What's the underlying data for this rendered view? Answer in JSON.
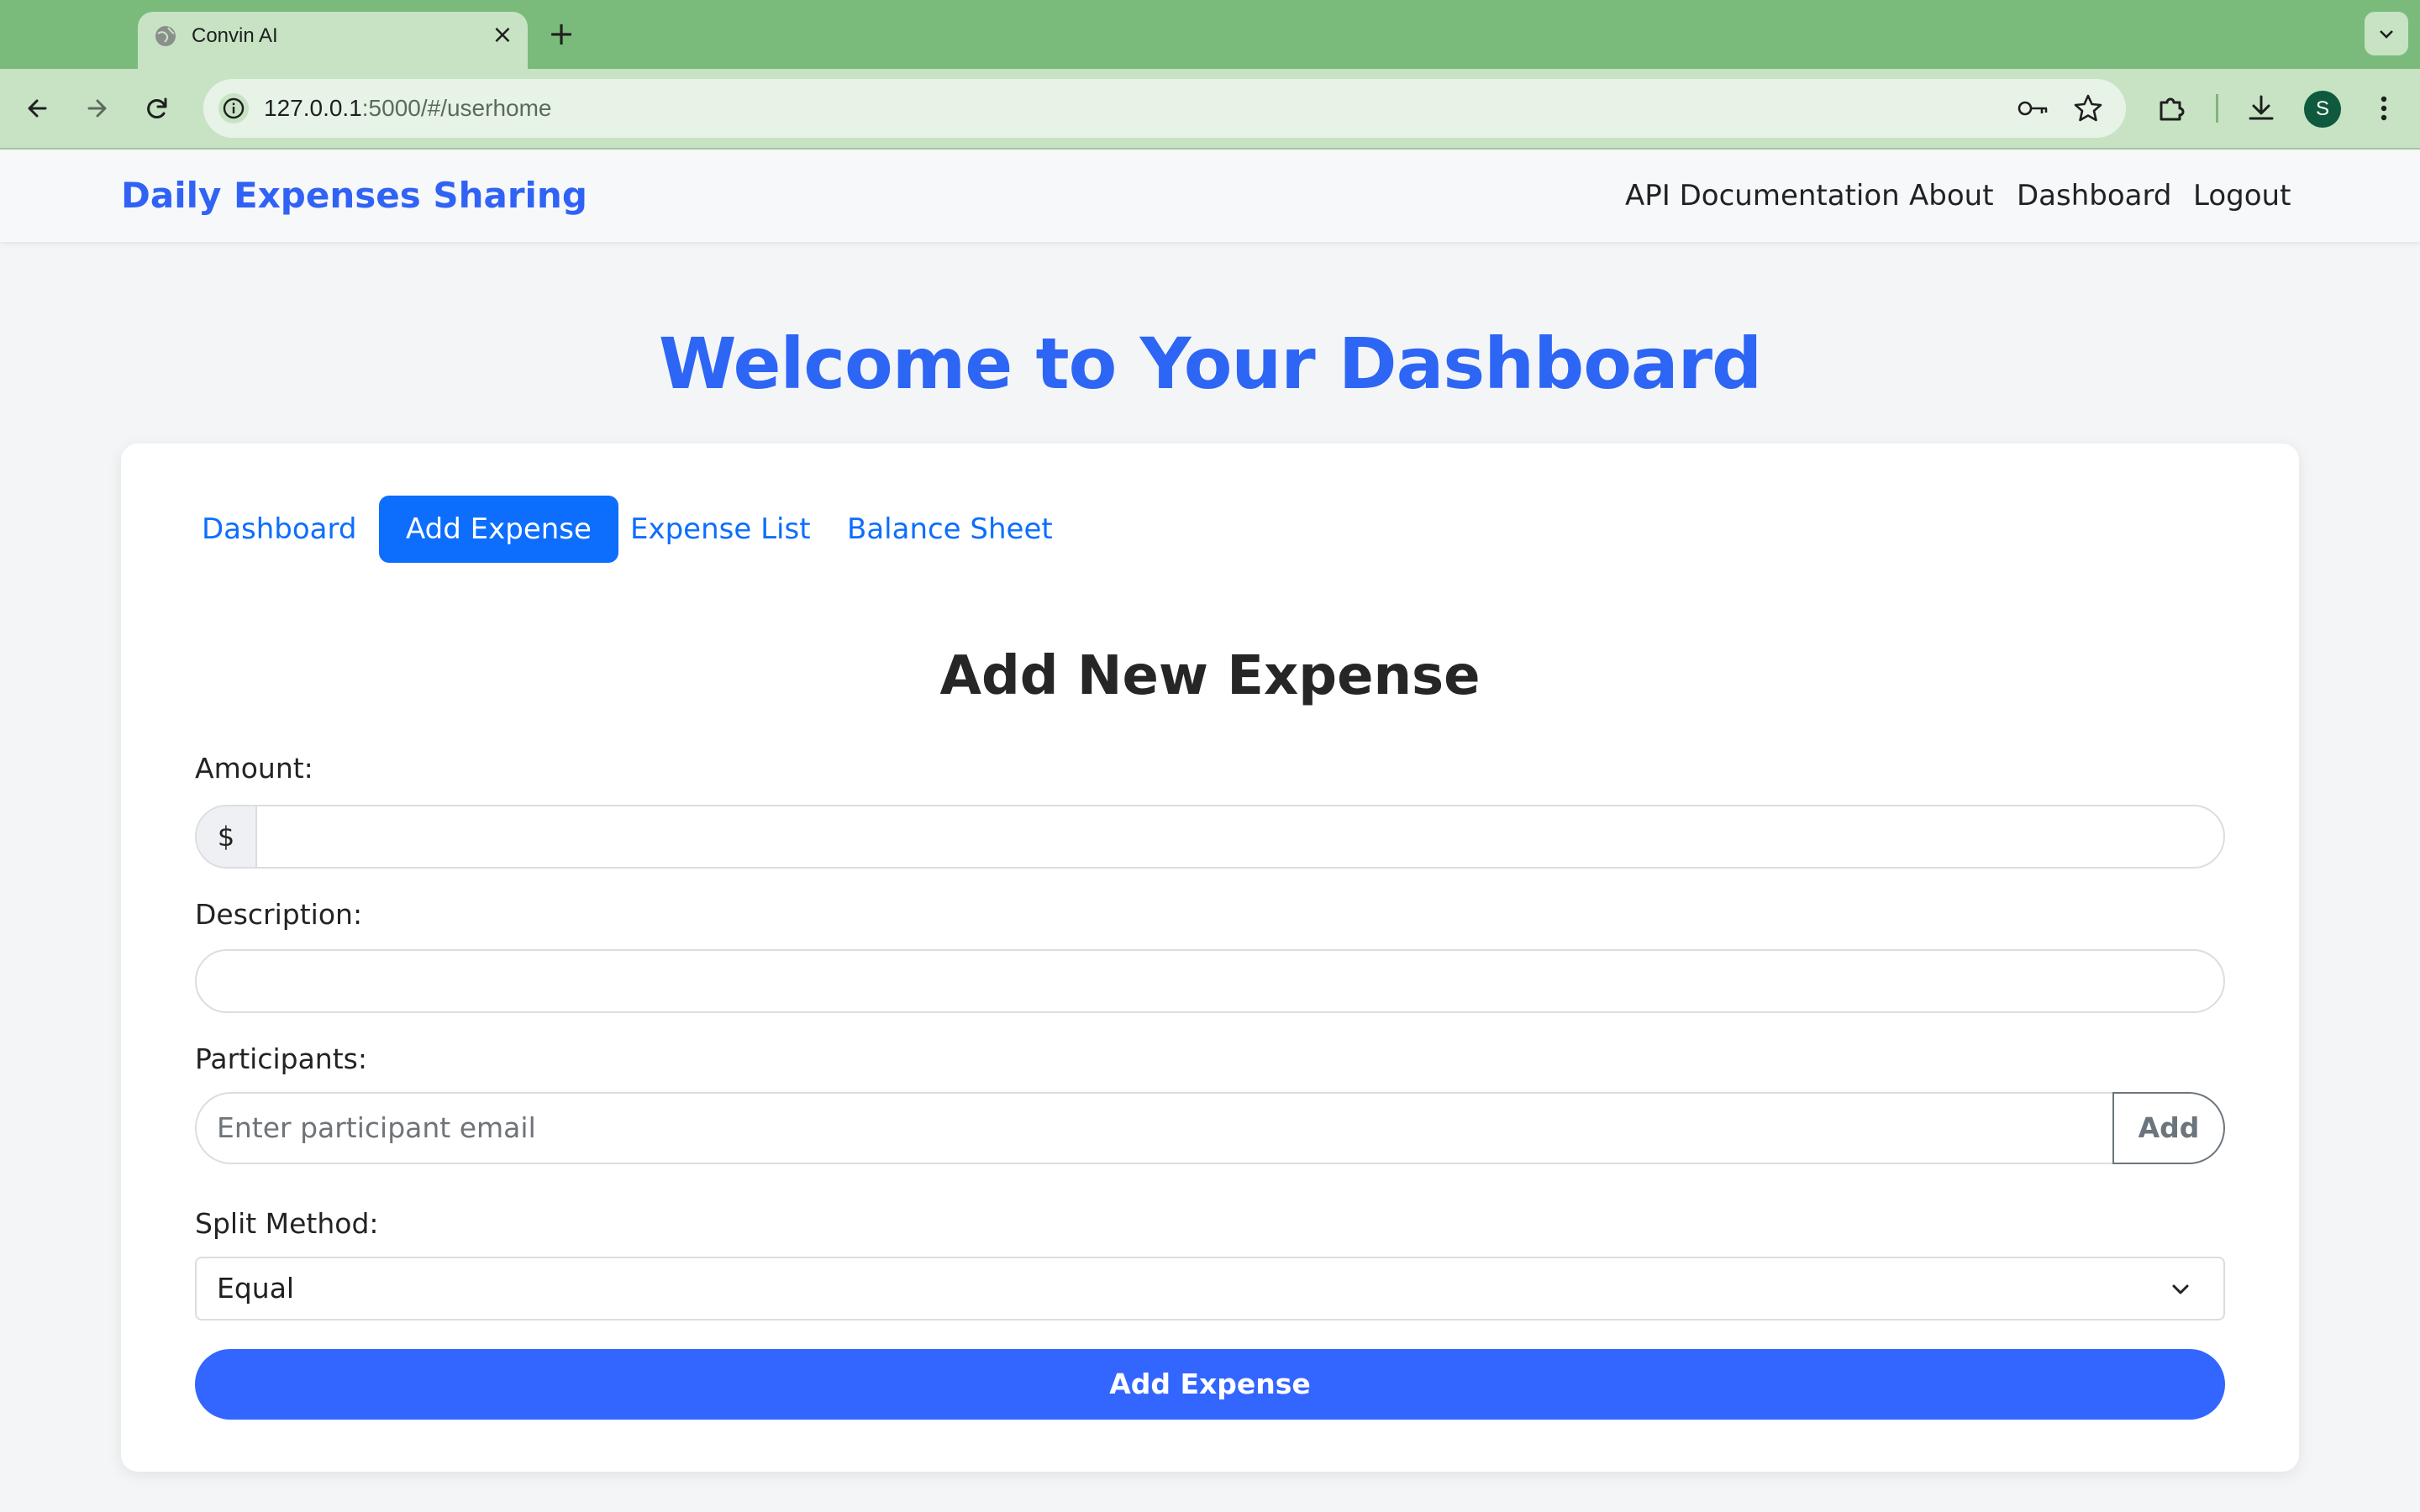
{
  "browser": {
    "tab_title": "Convin AI",
    "url_host": "127.0.0.1",
    "url_rest": ":5000/#/userhome",
    "profile_initial": "S"
  },
  "navbar": {
    "brand": "Daily Expenses Sharing",
    "links": [
      "API Documentation",
      "About",
      "Dashboard",
      "Logout"
    ]
  },
  "page": {
    "welcome": "Welcome to Your Dashboard",
    "tabs": [
      "Dashboard",
      "Add Expense",
      "Expense List",
      "Balance Sheet"
    ],
    "active_tab": "Add Expense"
  },
  "form": {
    "title": "Add New Expense",
    "amount_label": "Amount:",
    "currency_symbol": "$",
    "amount_value": "",
    "description_label": "Description:",
    "description_value": "",
    "participants_label": "Participants:",
    "participants_placeholder": "Enter participant email",
    "add_participant_label": "Add",
    "split_label": "Split Method:",
    "split_value": "Equal",
    "submit_label": "Add Expense"
  },
  "colors": {
    "brand": "#3063f5",
    "primary": "#0d6efd",
    "submit": "#3366ff",
    "chrome": "#7aba7a"
  }
}
